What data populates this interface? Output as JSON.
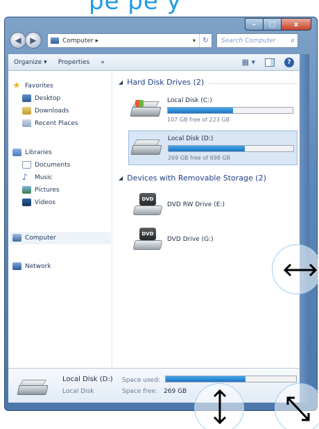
{
  "window": {
    "caption_min": "–",
    "caption_max": "□",
    "caption_close": "x"
  },
  "top_text": "pe   pe    y",
  "address": {
    "path": "Computer ▸",
    "dropdown": "▾",
    "refresh": "↻"
  },
  "search": {
    "placeholder": "Search Computer",
    "icon": "⌕"
  },
  "toolbar": {
    "organize": "Organize ▾",
    "properties": "Properties",
    "more": "»",
    "views": "▦ ▾",
    "help": "?"
  },
  "nav": {
    "favorites": "Favorites",
    "desktop": "Desktop",
    "downloads": "Downloads",
    "recent": "Recent Places",
    "libraries": "Libraries",
    "documents": "Documents",
    "music": "Music",
    "pictures": "Pictures",
    "videos": "Videos",
    "computer": "Computer",
    "network": "Network"
  },
  "groups": {
    "hdd_header": "Hard Disk Drives (2)",
    "removable_header": "Devices with Removable Storage (2)"
  },
  "drives": [
    {
      "name": "Local Disk (C:)",
      "free_text": "107 GB free of 223 GB",
      "used_fraction": 0.52
    },
    {
      "name": "Local Disk (D:)",
      "free_text": "269 GB free of 698 GB",
      "used_fraction": 0.61
    }
  ],
  "removable": [
    {
      "name": "DVD RW Drive (E:)",
      "badge": "DVD"
    },
    {
      "name": "DVD Drive (G:)",
      "badge": "DVD"
    }
  ],
  "details": {
    "name": "Local Disk (D:)",
    "type": "Local Disk",
    "space_used_label": "Space used:",
    "space_free_label": "Space free:",
    "space_free_value": "269 GB",
    "used_fraction": 0.61
  }
}
